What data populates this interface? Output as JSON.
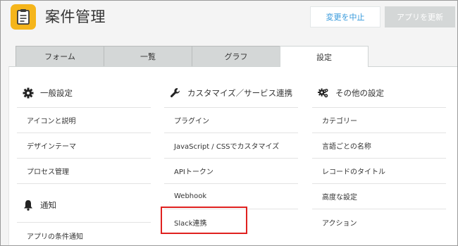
{
  "app": {
    "title": "案件管理",
    "icon": "notepad-icon",
    "icon_color": "#f5b51b"
  },
  "header": {
    "cancel_label": "変更を中止",
    "update_label": "アプリを更新"
  },
  "tabs": [
    {
      "label": "フォーム"
    },
    {
      "label": "一覧"
    },
    {
      "label": "グラフ"
    },
    {
      "label": "設定",
      "active": true
    }
  ],
  "sections": {
    "general": {
      "title": "一般設定",
      "icon": "gear-icon",
      "items": [
        "アイコンと説明",
        "デザインテーマ",
        "プロセス管理"
      ]
    },
    "notify": {
      "title": "通知",
      "icon": "bell-icon",
      "items": [
        "アプリの条件通知"
      ]
    },
    "customize": {
      "title": "カスタマイズ／サービス連携",
      "icon": "wrench-icon",
      "items": [
        "プラグイン",
        "JavaScript / CSSでカスタマイズ",
        "APIトークン",
        "Webhook",
        "Slack連携"
      ]
    },
    "other": {
      "title": "その他の設定",
      "icon": "gears-icon",
      "items": [
        "カテゴリー",
        "言語ごとの名称",
        "レコードのタイトル",
        "高度な設定",
        "アクション"
      ]
    }
  },
  "highlight": {
    "target": "Slack連携",
    "color": "#e0211f"
  }
}
